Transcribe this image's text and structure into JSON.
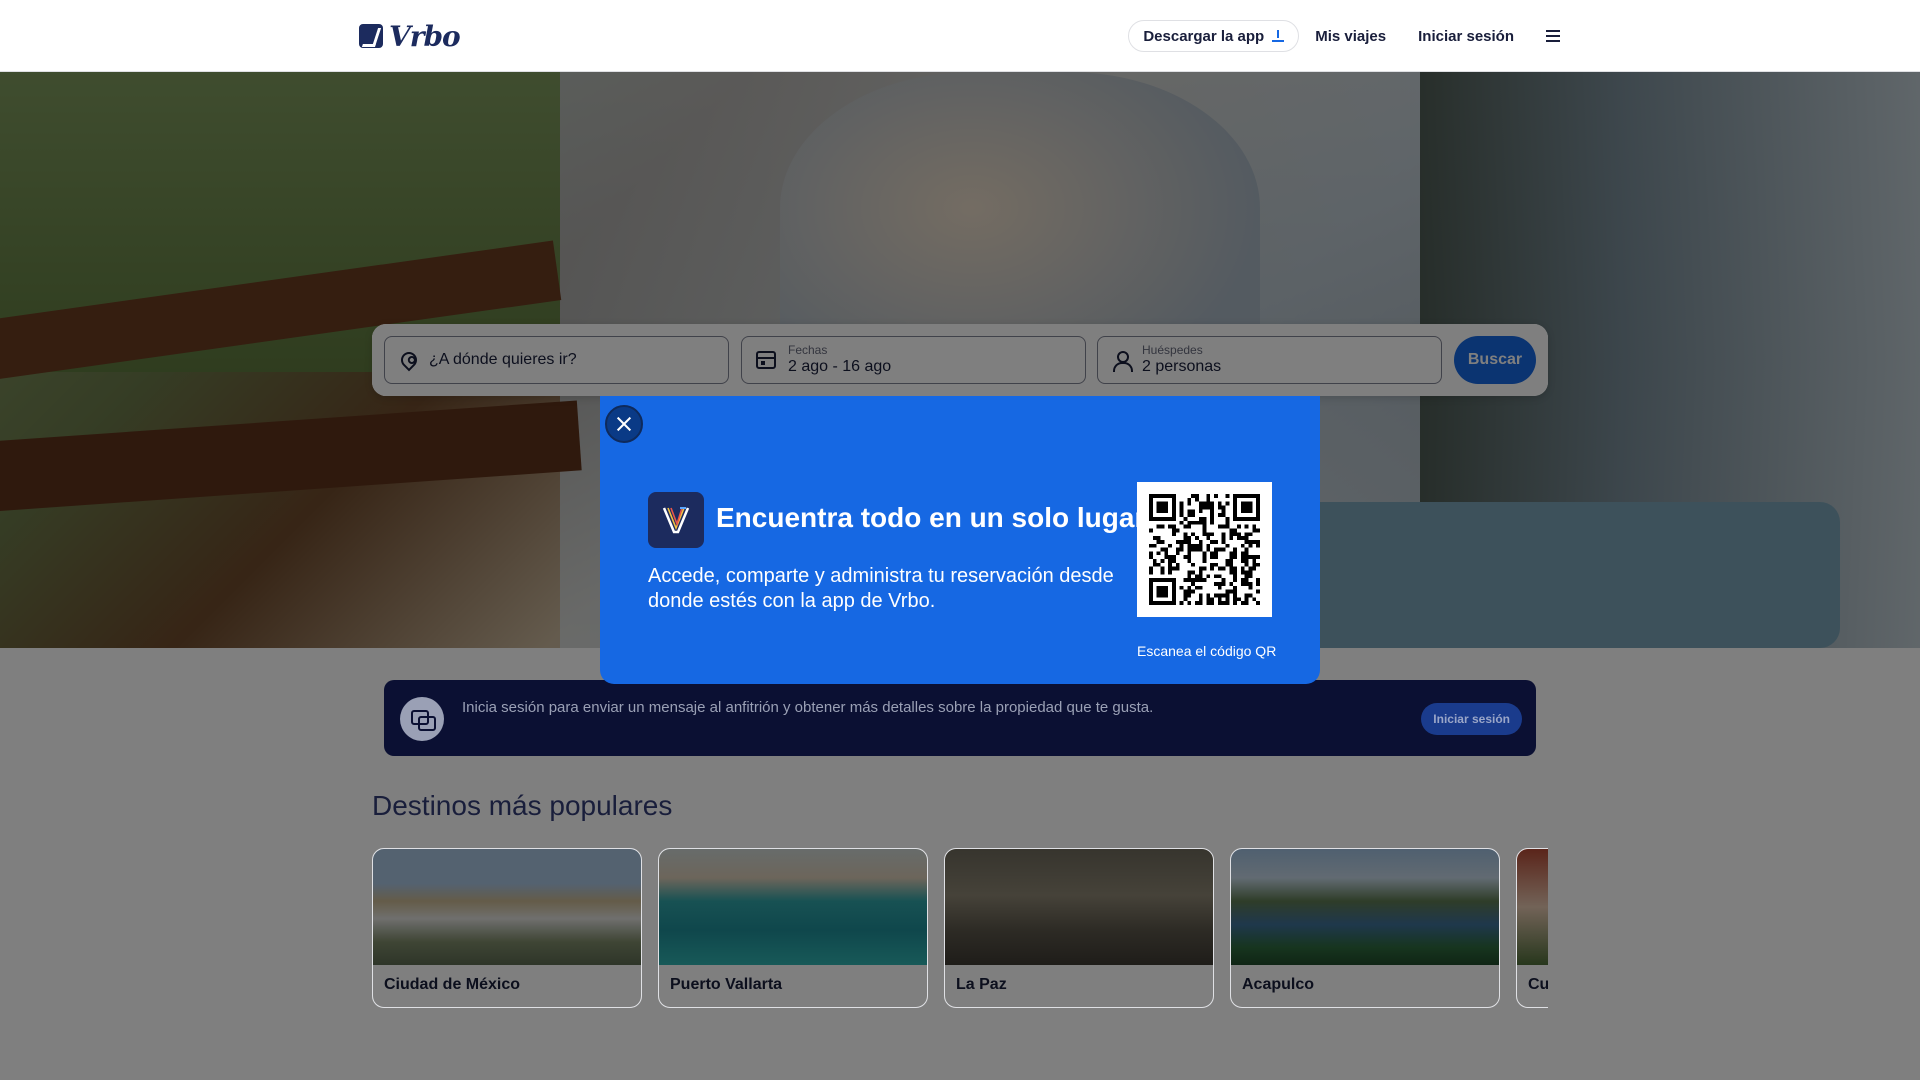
{
  "header": {
    "logo_text": "Vrbo",
    "nav": {
      "download_app": "Descargar la app",
      "my_trips": "Mis viajes",
      "sign_in": "Iniciar sesión"
    }
  },
  "search": {
    "destination_placeholder": "¿A dónde quieres ir?",
    "dates_label": "Fechas",
    "dates_value": "2 ago - 16 ago",
    "guests_label": "Huéspedes",
    "guests_value": "2 personas",
    "search_button": "Buscar"
  },
  "modal": {
    "title": "Encuentra todo en un solo lugar",
    "body": "Accede, comparte y administra tu reservación desde donde estés con la app de Vrbo.",
    "qr_caption": "Escanea el código QR"
  },
  "banner": {
    "text": "Inicia sesión para enviar un mensaje al anfitrión y obtener más detalles sobre la propiedad que te gusta.",
    "button": "Iniciar sesión"
  },
  "destinations": {
    "title": "Destinos más populares",
    "items": [
      {
        "name": "Ciudad de México"
      },
      {
        "name": "Puerto Vallarta"
      },
      {
        "name": "La Paz"
      },
      {
        "name": "Acapulco"
      },
      {
        "name": "Cu"
      }
    ]
  },
  "colors": {
    "brand_blue": "#1668e3",
    "brand_navy": "#1c2b5e",
    "banner_bg": "#0b1033"
  },
  "icons": [
    "download-icon",
    "menu-icon",
    "location-pin-icon",
    "calendar-icon",
    "person-icon",
    "close-icon",
    "chat-icon",
    "vrbo-app-icon",
    "qr-code"
  ]
}
